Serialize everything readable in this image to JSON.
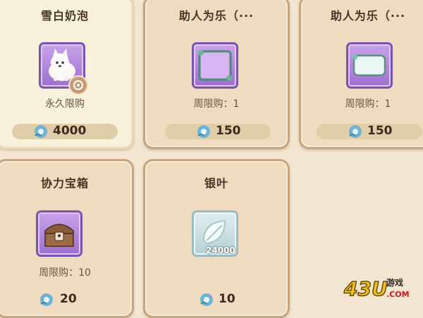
{
  "items": [
    {
      "name": "雪白奶泡",
      "limit": "永久限购",
      "price": "4000",
      "icon": "white-dog-icon"
    },
    {
      "name": "助人为乐（···",
      "limit": "周限购：1",
      "price": "150",
      "icon": "purple-frame-icon"
    },
    {
      "name": "助人为乐（···",
      "limit": "周限购：1",
      "price": "150",
      "icon": "bubble-frame-icon"
    },
    {
      "name": "协力宝箱",
      "limit": "周限购：10",
      "price": "20",
      "icon": "treasure-chest-icon"
    },
    {
      "name": "银叶",
      "limit": "",
      "price": "10",
      "icon": "silver-leaf-icon",
      "quantity": "24000"
    }
  ],
  "currency_icon": "blue-flower-gem-icon",
  "watermark": {
    "number": "43U",
    "text": "游戏",
    "domain": ".COM"
  }
}
